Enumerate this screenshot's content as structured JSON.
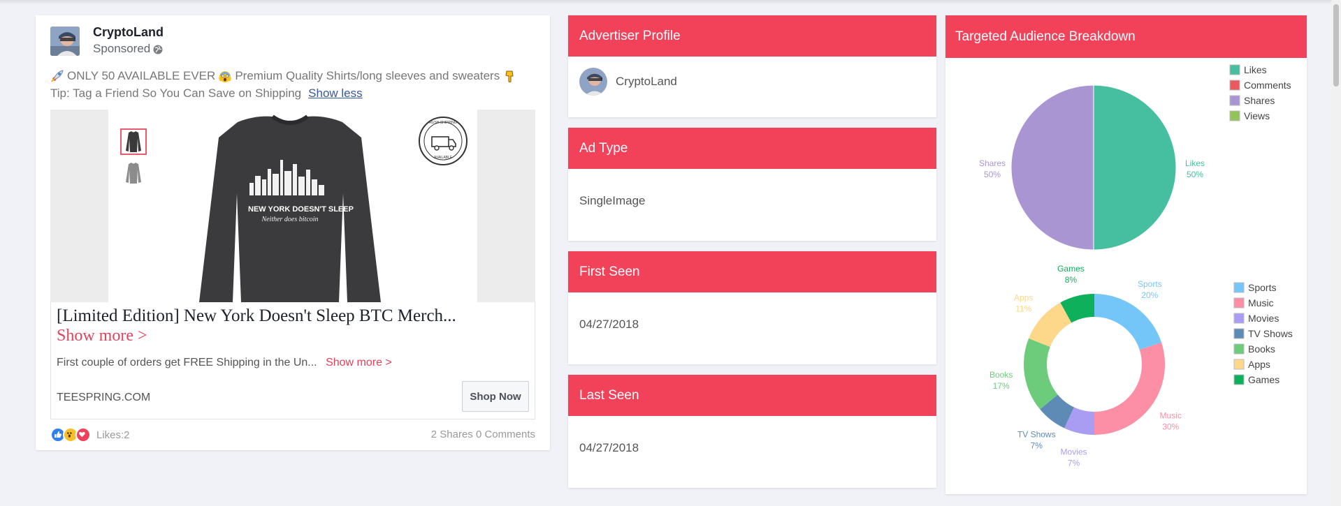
{
  "ad": {
    "brand_name": "CryptoLand",
    "sponsored": "Sponsored",
    "text_line1": "ONLY 50 AVAILABLE EVER",
    "text_line1b": "Premium Quality Shirts/long sleeves and sweaters",
    "text_line2": "Tip: Tag a Friend So You Can Save on Shipping",
    "show_less": "Show less",
    "image_text_main": "NEW YORK DOESN'T SLEEP",
    "image_text_sub": "Neither does bitcoin",
    "stamp_text_top": "RUSH SHIPPING",
    "stamp_text_bottom": "AVAILABLE",
    "title": "[Limited Edition] New York Doesn't Sleep BTC Merch...",
    "show_more": "Show more >",
    "description": "First couple of orders get FREE Shipping in the Un...",
    "description_more": "Show more >",
    "domain": "TEESPRING.COM",
    "cta": "Shop Now",
    "likes": "Likes:2",
    "shares_comments": "2 Shares 0 Comments"
  },
  "profile": {
    "title": "Advertiser Profile",
    "name": "CryptoLand"
  },
  "ad_type": {
    "title": "Ad Type",
    "value": "SingleImage"
  },
  "first_seen": {
    "title": "First Seen",
    "value": "04/27/2018"
  },
  "last_seen": {
    "title": "Last Seen",
    "value": "04/27/2018"
  },
  "audience": {
    "title": "Targeted Audience Breakdown"
  },
  "chart_data": [
    {
      "type": "pie",
      "categories": [
        "Likes",
        "Comments",
        "Shares",
        "Views"
      ],
      "values": [
        50,
        0,
        50,
        0
      ],
      "colors": [
        "#45bf9f",
        "#e85a5f",
        "#a995d2",
        "#92c45a"
      ],
      "slice_labels": [
        {
          "category": "Likes",
          "percent": "50%"
        },
        {
          "category": "Shares",
          "percent": "50%"
        }
      ],
      "legend": "top-right"
    },
    {
      "type": "pie",
      "donut": true,
      "categories": [
        "Sports",
        "Music",
        "Movies",
        "TV Shows",
        "Books",
        "Apps",
        "Games"
      ],
      "values": [
        20,
        30,
        7,
        7,
        17,
        11,
        8
      ],
      "colors": [
        "#75c6f8",
        "#fc8ea5",
        "#a99cf3",
        "#5e8bb5",
        "#6dcc7c",
        "#fdd88a",
        "#0fb05b"
      ],
      "slice_labels": [
        {
          "category": "Sports",
          "percent": "20%"
        },
        {
          "category": "Music",
          "percent": "30%"
        },
        {
          "category": "Movies",
          "percent": "7%"
        },
        {
          "category": "TV Shows",
          "percent": "7%"
        },
        {
          "category": "Books",
          "percent": "17%"
        },
        {
          "category": "Apps",
          "percent": "11%"
        },
        {
          "category": "Games",
          "percent": "8%"
        }
      ],
      "legend": "right"
    }
  ]
}
